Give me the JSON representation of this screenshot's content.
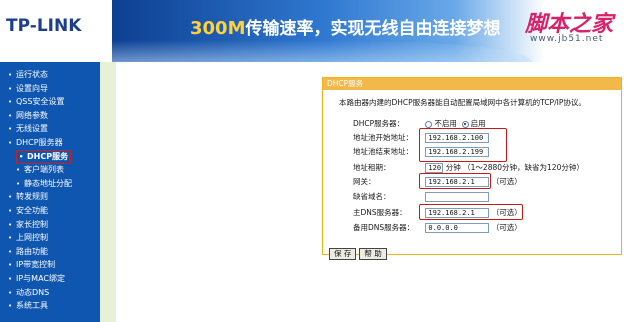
{
  "header": {
    "logo": "TP-LINK",
    "slogan_highlight": "300M",
    "slogan_rest": "传输速率，实现无线自由连接梦想",
    "watermark_title": "脚本之家",
    "watermark_url": "www.jb51.net"
  },
  "sidebar": {
    "items": [
      {
        "label": "运行状态"
      },
      {
        "label": "设置向导"
      },
      {
        "label": "QSS安全设置"
      },
      {
        "label": "网络参数"
      },
      {
        "label": "无线设置"
      },
      {
        "label": "DHCP服务器"
      },
      {
        "label": "DHCP服务"
      },
      {
        "label": "客户端列表"
      },
      {
        "label": "静态地址分配"
      },
      {
        "label": "转发规则"
      },
      {
        "label": "安全功能"
      },
      {
        "label": "家长控制"
      },
      {
        "label": "上网控制"
      },
      {
        "label": "路由功能"
      },
      {
        "label": "IP带宽控制"
      },
      {
        "label": "IP与MAC绑定"
      },
      {
        "label": "动态DNS"
      },
      {
        "label": "系统工具"
      }
    ]
  },
  "panel": {
    "title": "DHCP服务",
    "description": "本路由器内建的DHCP服务器能自动配置局域网中各计算机的TCP/IP协议。",
    "dhcp_server_label": "DHCP服务器：",
    "disable_label": "不启用",
    "enable_label": "启用",
    "start_label": "地址池开始地址：",
    "start_value": "192.168.2.100",
    "end_label": "地址池结束地址：",
    "end_value": "192.168.2.199",
    "lease_label": "地址租期：",
    "lease_value": "120",
    "lease_hint": "分钟 （1～2880分钟，缺省为120分钟）",
    "gateway_label": "网关：",
    "gateway_value": "192.168.2.1",
    "domain_label": "缺省域名：",
    "domain_value": "",
    "primary_dns_label": "主DNS服务器：",
    "primary_dns_value": "192.168.2.1",
    "secondary_dns_label": "备用DNS服务器：",
    "secondary_dns_value": "0.0.0.0",
    "optional": "（可选）",
    "save_label": "保 存",
    "help_label": "帮 助"
  }
}
